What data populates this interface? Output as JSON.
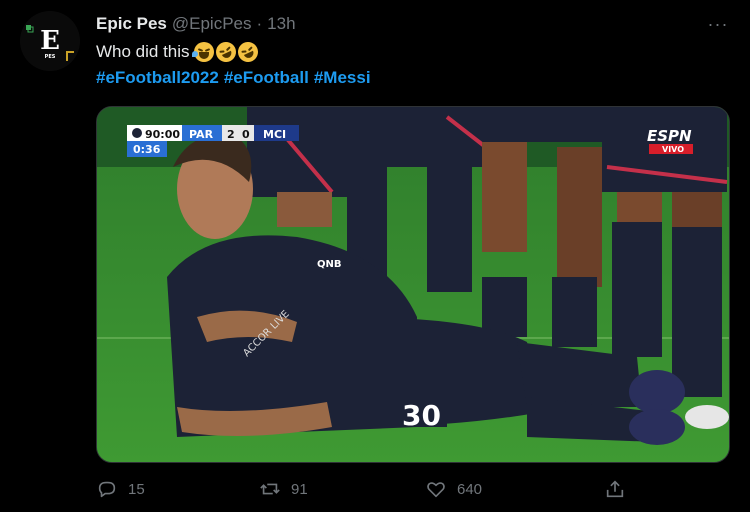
{
  "author": {
    "name": "Epic Pes",
    "handle": "@EpicPes",
    "separator": "·",
    "time": "13h"
  },
  "tweet": {
    "text": "Who did this",
    "emojis": [
      "loudly-crying-face",
      "rolling-on-the-floor-laughing",
      "rolling-on-the-floor-laughing"
    ],
    "hashtags": [
      "#eFootball2022",
      "#eFootball",
      "#Messi"
    ]
  },
  "media": {
    "scoreboard": {
      "match_time": "90:00",
      "extra_time": "0:36",
      "home": "PAR",
      "home_score": "2",
      "away_score": "0",
      "away": "MCI"
    },
    "broadcaster": "ESPN",
    "broadcaster_tag": "VIVO",
    "sponsor": "QNB",
    "shirt_sponsor": "ACCOR LIVE",
    "shirt_number": "30"
  },
  "actions": {
    "replies": "15",
    "retweets": "91",
    "likes": "640"
  },
  "more_label": "···",
  "colors": {
    "background": "#000000",
    "accent": "#1d9bf0",
    "muted": "#71767b",
    "text": "#e7e9ea"
  }
}
